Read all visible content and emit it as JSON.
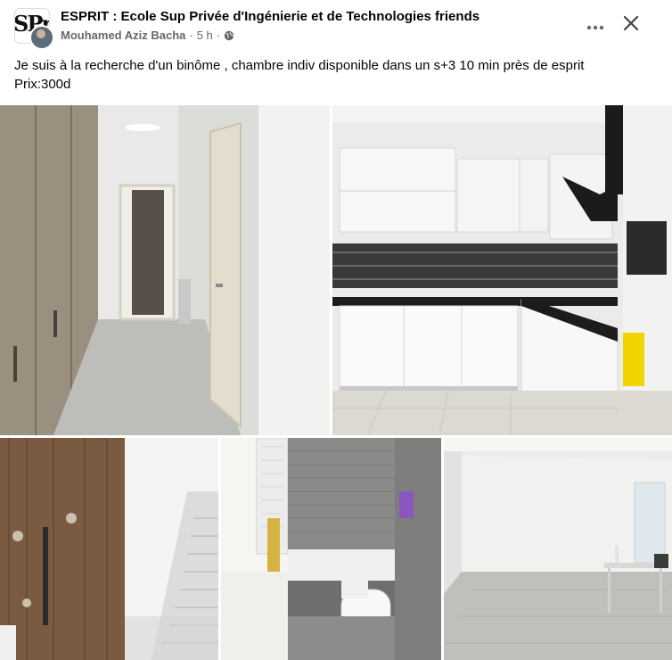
{
  "post": {
    "group_name": "ESPRIT : Ecole Sup Privée d'Ingénierie et de Technologies friends",
    "author": "Mouhamed Aziz Bacha",
    "separator": "·",
    "time": "5 h",
    "separator2": "·",
    "logo_text": "SPr",
    "body_lines": [
      "Je suis à la recherche d'un binôme , chambre indiv disponible dans un s+3 10 min près de esprit",
      "Prix:300d"
    ]
  },
  "icons": {
    "privacy": "globe-icon",
    "more": "more-dots-icon",
    "close": "close-icon"
  },
  "colors": {
    "text_primary": "#050505",
    "text_secondary": "#65676b",
    "background": "#ffffff"
  },
  "photos": [
    {
      "subject": "hallway-with-wardrobe"
    },
    {
      "subject": "white-kitchen"
    },
    {
      "subject": "entrance-door-and-stairs"
    },
    {
      "subject": "bathroom"
    },
    {
      "subject": "empty-living-room"
    }
  ]
}
